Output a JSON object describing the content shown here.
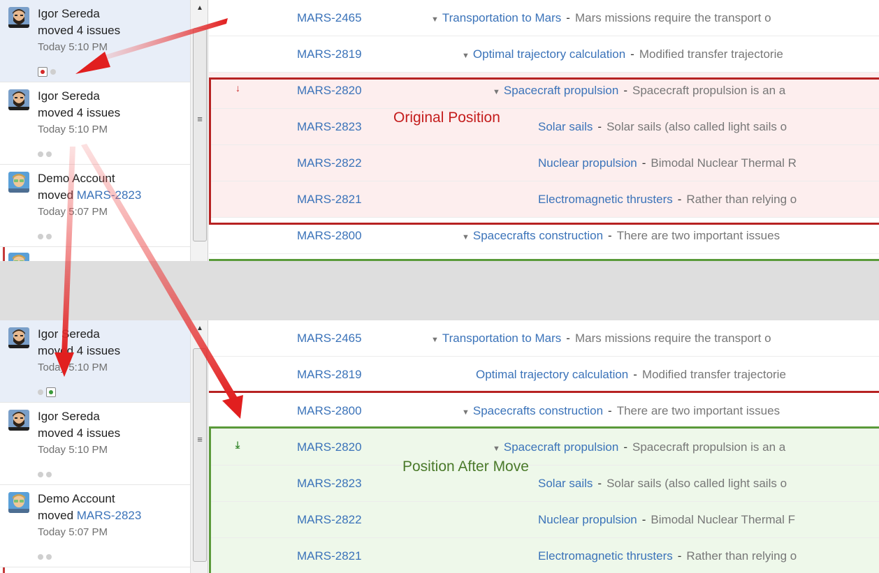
{
  "colors": {
    "link": "#3b73b9",
    "original_highlight": "#fdeeee",
    "moved_highlight": "#eef8ea",
    "red_marker": "#c82a2a",
    "green_marker": "#3a8a32"
  },
  "top_panel": {
    "callout": "Original Position",
    "activity": [
      {
        "user": "Igor Sereda",
        "action": "moved 4 issues",
        "link": "",
        "time": "Today 5:10 PM",
        "selected": true,
        "avatar": "bearded-man-avatar",
        "dots": [
          "red-selected",
          "grey"
        ]
      },
      {
        "user": "Igor Sereda",
        "action": "moved 4 issues",
        "link": "",
        "time": "Today 5:10 PM",
        "selected": false,
        "avatar": "bearded-man-avatar",
        "dots": [
          "grey",
          "grey"
        ]
      },
      {
        "user": "Demo Account",
        "action": "moved ",
        "link": "MARS-2823",
        "time": "Today 5:07 PM",
        "selected": false,
        "avatar": "demo-avatar",
        "dots": [
          "grey",
          "grey"
        ]
      }
    ],
    "rows": [
      {
        "key": "MARS-2465",
        "title": "Transportation to Mars",
        "desc": "Mars missions require the transport o",
        "caret": true
      },
      {
        "key": "MARS-2819",
        "title": "Optimal trajectory calculation",
        "desc": "Modified transfer trajectorie",
        "caret": true
      },
      {
        "key": "MARS-2820",
        "title": "Spacecraft propulsion",
        "desc": "Spacecraft propulsion is an a",
        "caret": true,
        "marker": "↓"
      },
      {
        "key": "MARS-2823",
        "title": "Solar sails",
        "desc": "Solar sails (also called light sails o",
        "caret": false
      },
      {
        "key": "MARS-2822",
        "title": "Nuclear propulsion",
        "desc": "Bimodal Nuclear Thermal R",
        "caret": false
      },
      {
        "key": "MARS-2821",
        "title": "Electromagnetic thrusters",
        "desc": "Rather than relying o",
        "caret": false
      },
      {
        "key": "MARS-2800",
        "title": "Spacecrafts construction",
        "desc": "There are two important issues",
        "caret": true
      }
    ]
  },
  "bottom_panel": {
    "callout": "Position After Move",
    "activity": [
      {
        "user": "Igor Sereda",
        "action": "moved 4 issues",
        "link": "",
        "time": "Today 5:10 PM",
        "selected": true,
        "avatar": "bearded-man-avatar",
        "dots": [
          "grey",
          "green-selected"
        ]
      },
      {
        "user": "Igor Sereda",
        "action": "moved 4 issues",
        "link": "",
        "time": "Today 5:10 PM",
        "selected": false,
        "avatar": "bearded-man-avatar",
        "dots": [
          "grey",
          "grey"
        ]
      },
      {
        "user": "Demo Account",
        "action": "moved ",
        "link": "MARS-2823",
        "time": "Today 5:07 PM",
        "selected": false,
        "avatar": "demo-avatar",
        "dots": [
          "grey",
          "grey"
        ]
      }
    ],
    "rows": [
      {
        "key": "MARS-2465",
        "title": "Transportation to Mars",
        "desc": "Mars missions require the transport o",
        "caret": true
      },
      {
        "key": "MARS-2819",
        "title": "Optimal trajectory calculation",
        "desc": "Modified transfer trajectorie",
        "caret": false
      },
      {
        "key": "MARS-2800",
        "title": "Spacecrafts construction",
        "desc": "There are two important issues",
        "caret": true
      },
      {
        "key": "MARS-2820",
        "title": "Spacecraft propulsion",
        "desc": "Spacecraft propulsion is an a",
        "caret": true,
        "marker": "⤓"
      },
      {
        "key": "MARS-2823",
        "title": "Solar sails",
        "desc": "Solar sails (also called light sails o",
        "caret": false
      },
      {
        "key": "MARS-2822",
        "title": "Nuclear propulsion",
        "desc": "Bimodal Nuclear Thermal F",
        "caret": false
      },
      {
        "key": "MARS-2821",
        "title": "Electromagnetic thrusters",
        "desc": "Rather than relying o",
        "caret": false
      }
    ]
  },
  "icons": {
    "scroll_up": "scroll-up-arrow-icon",
    "grip": "scrollbar-grip-icon",
    "caret": "expand-caret-icon"
  }
}
